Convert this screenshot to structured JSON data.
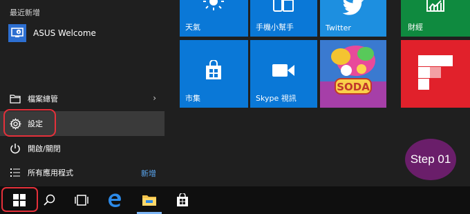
{
  "start_menu": {
    "recent_label": "最近新增",
    "recent_app": {
      "label": "ASUS Welcome",
      "icon": "asus-welcome-icon"
    },
    "items": [
      {
        "label": "檔案總管",
        "icon": "folder-icon",
        "trailing": "›"
      },
      {
        "label": "設定",
        "icon": "gear-icon"
      },
      {
        "label": "開啟/關閉",
        "icon": "power-icon"
      },
      {
        "label": "所有應用程式",
        "icon": "list-icon",
        "badge": "新增"
      }
    ]
  },
  "tiles": {
    "weather": {
      "label": "天氣",
      "icon": "sun-icon"
    },
    "phone": {
      "label": "手機小幫手",
      "icon": "phone-icon"
    },
    "twitter": {
      "label": "Twitter",
      "icon": "twitter-bird-icon"
    },
    "finance": {
      "label": "財經",
      "icon": "chart-icon",
      "color": "#0f8a3f"
    },
    "store": {
      "label": "市集",
      "icon": "store-bag-icon"
    },
    "skype": {
      "label": "Skype 視訊",
      "icon": "video-camera-icon"
    },
    "candy": {
      "logo_text": "SODA"
    },
    "flipboard": {
      "color": "#e1212b",
      "icon": "flipboard-icon"
    }
  },
  "taskbar": {
    "buttons": [
      "windows-start-icon",
      "search-icon",
      "task-view-icon",
      "edge-icon",
      "file-explorer-icon",
      "store-icon"
    ]
  },
  "step_badge": "Step 01",
  "colors": {
    "tile_blue": "#0a78d7",
    "highlight": "#e5303a",
    "badge": "#6a1e6a"
  }
}
